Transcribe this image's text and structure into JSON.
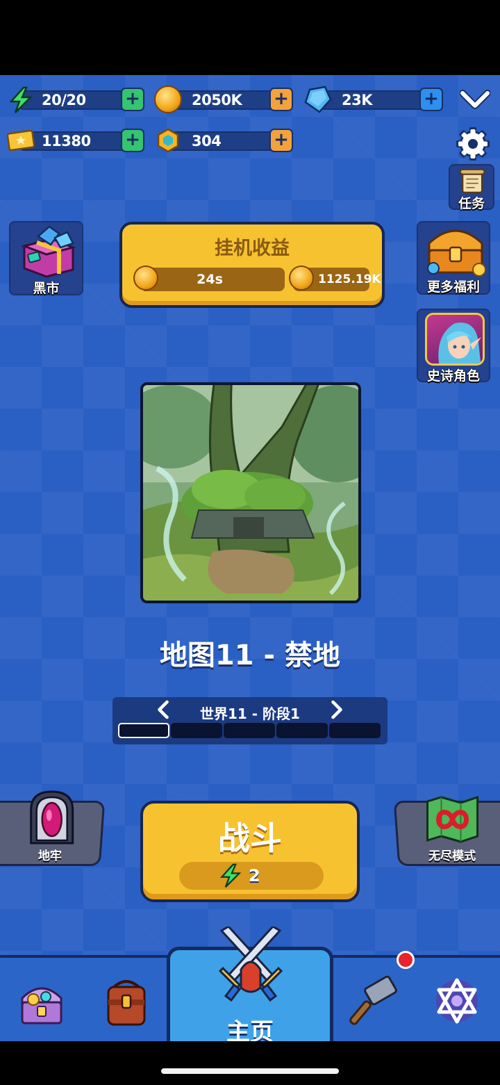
{
  "resources": {
    "energy": {
      "value": "20/20",
      "icon": "lightning-icon",
      "plus": "green"
    },
    "gold": {
      "value": "2050K",
      "icon": "gold-coin-icon",
      "plus": "orange"
    },
    "gems": {
      "value": "23K",
      "icon": "blue-gem-icon",
      "plus": "blue"
    },
    "tickets": {
      "value": "11380",
      "icon": "ticket-icon",
      "plus": "green"
    },
    "tokens": {
      "value": "304",
      "icon": "hex-token-icon",
      "plus": "orange"
    },
    "plus_glyph": "+"
  },
  "side_buttons": {
    "black_market": "黑市",
    "tasks": "任务",
    "more_benefits": "更多福利",
    "epic_hero": "史诗角色"
  },
  "idle": {
    "title": "挂机收益",
    "timer": "24s",
    "earnings": "1125.19K",
    "progress": 0.06
  },
  "map": {
    "title": "地图11 - 禁地",
    "stage_label": "世界11 - 阶段1",
    "stages_total": 5,
    "stage_current": 1
  },
  "battle": {
    "label": "战斗",
    "cost": "2"
  },
  "modes": {
    "dungeon": "地牢",
    "endless": "无尽模式"
  },
  "nav": {
    "home": "主页",
    "items": [
      "treasure-chest-icon",
      "backpack-icon",
      "crossed-swords-icon",
      "hammer-icon",
      "magic-star-icon"
    ]
  },
  "colors": {
    "background": "#2a5fc4",
    "yellow_button": "#f7c230",
    "nav_active": "#3fa2e8",
    "notification": "#e8232a"
  }
}
